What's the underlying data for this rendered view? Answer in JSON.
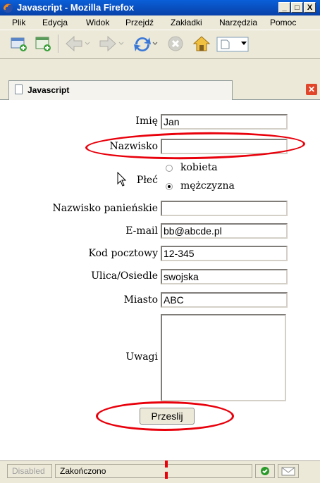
{
  "window": {
    "title": "Javascript - Mozilla Firefox",
    "buttons": [
      "_",
      "□",
      "X"
    ]
  },
  "menu": [
    "Plik",
    "Edycja",
    "Widok",
    "Przejdź",
    "Zakładki",
    "Narzędzia",
    "Pomoc"
  ],
  "toolbar_icons": [
    "new-window-icon",
    "new-tab-icon",
    "back-icon",
    "forward-icon",
    "reload-icon",
    "stop-icon",
    "home-icon",
    "page-icon"
  ],
  "tab": {
    "label": "Javascript"
  },
  "form": {
    "imie": {
      "label": "Imię",
      "value": "Jan"
    },
    "nazwisko": {
      "label": "Nazwisko",
      "value": ""
    },
    "plec": {
      "label": "Płeć",
      "options": [
        "kobieta",
        "mężczyzna"
      ],
      "selected": "mężczyzna"
    },
    "nazwisko_panienskie": {
      "label": "Nazwisko panieńskie",
      "value": ""
    },
    "email": {
      "label": "E-mail",
      "value": "bb@abcde.pl"
    },
    "kod": {
      "label": "Kod pocztowy",
      "value": "12-345"
    },
    "ulica": {
      "label": "Ulica/Osiedle",
      "value": "swojska"
    },
    "miasto": {
      "label": "Miasto",
      "value": "ABC"
    },
    "uwagi": {
      "label": "Uwagi",
      "value": ""
    },
    "submit": "Przeslij"
  },
  "status": {
    "disabled": "Disabled",
    "text": "Zakończono"
  },
  "colors": {
    "annotation": "#e8000b",
    "titlebar": "#0a5fd8"
  }
}
